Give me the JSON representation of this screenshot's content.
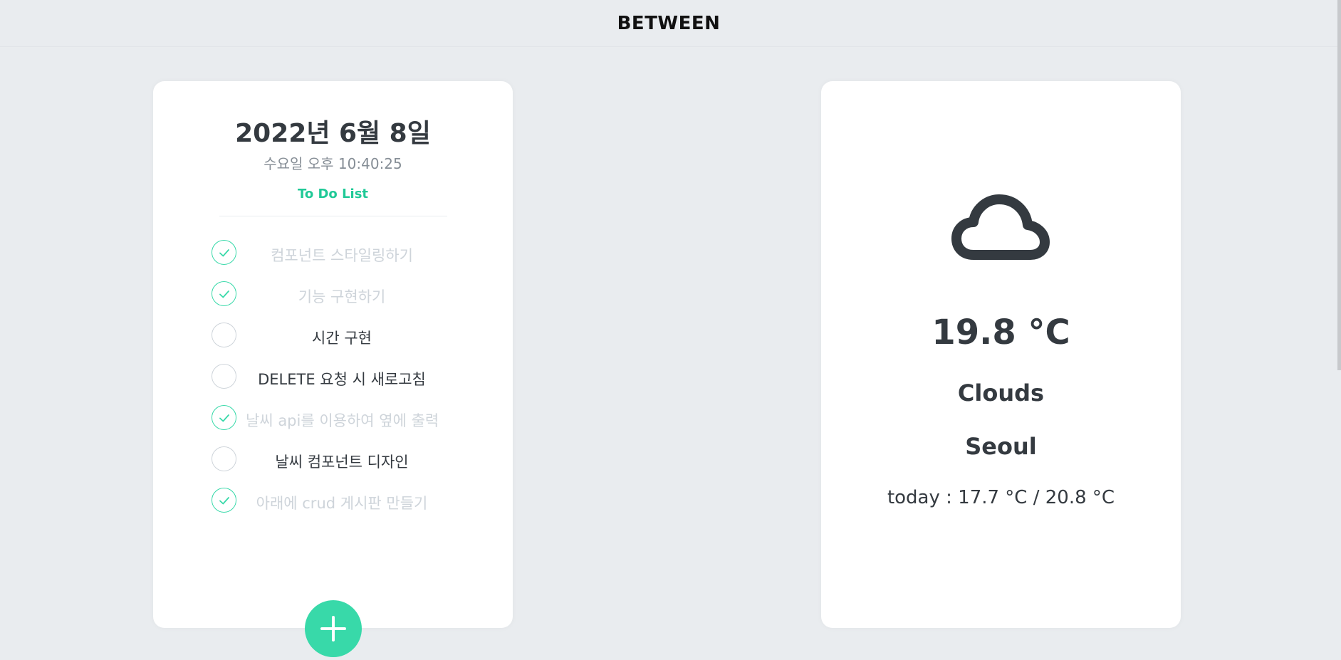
{
  "app": {
    "title": "BETWEEN"
  },
  "todo": {
    "date": "2022년 6월 8일",
    "day_time": "수요일 오후 10:40:25",
    "list_title": "To Do List",
    "items": [
      {
        "text": "컴포넌트 스타일링하기",
        "done": true
      },
      {
        "text": "기능 구현하기",
        "done": true
      },
      {
        "text": "시간 구현",
        "done": false
      },
      {
        "text": "DELETE 요청 시 새로고침",
        "done": false
      },
      {
        "text": "날씨 api를 이용하여 옆에 출력",
        "done": true
      },
      {
        "text": "날씨 컴포넌트 디자인",
        "done": false
      },
      {
        "text": "아래에 crud 게시판 만들기",
        "done": true
      }
    ],
    "add_icon": "plus-icon"
  },
  "weather": {
    "icon": "cloud-icon",
    "temperature": "19.8 °C",
    "condition": "Clouds",
    "city": "Seoul",
    "range": "today : 17.7 °C / 20.8 °C"
  },
  "colors": {
    "accent": "#20c997",
    "check": "#38d9a9",
    "background": "#e9ecef",
    "text": "#343a40",
    "done_text": "#ced4da"
  }
}
